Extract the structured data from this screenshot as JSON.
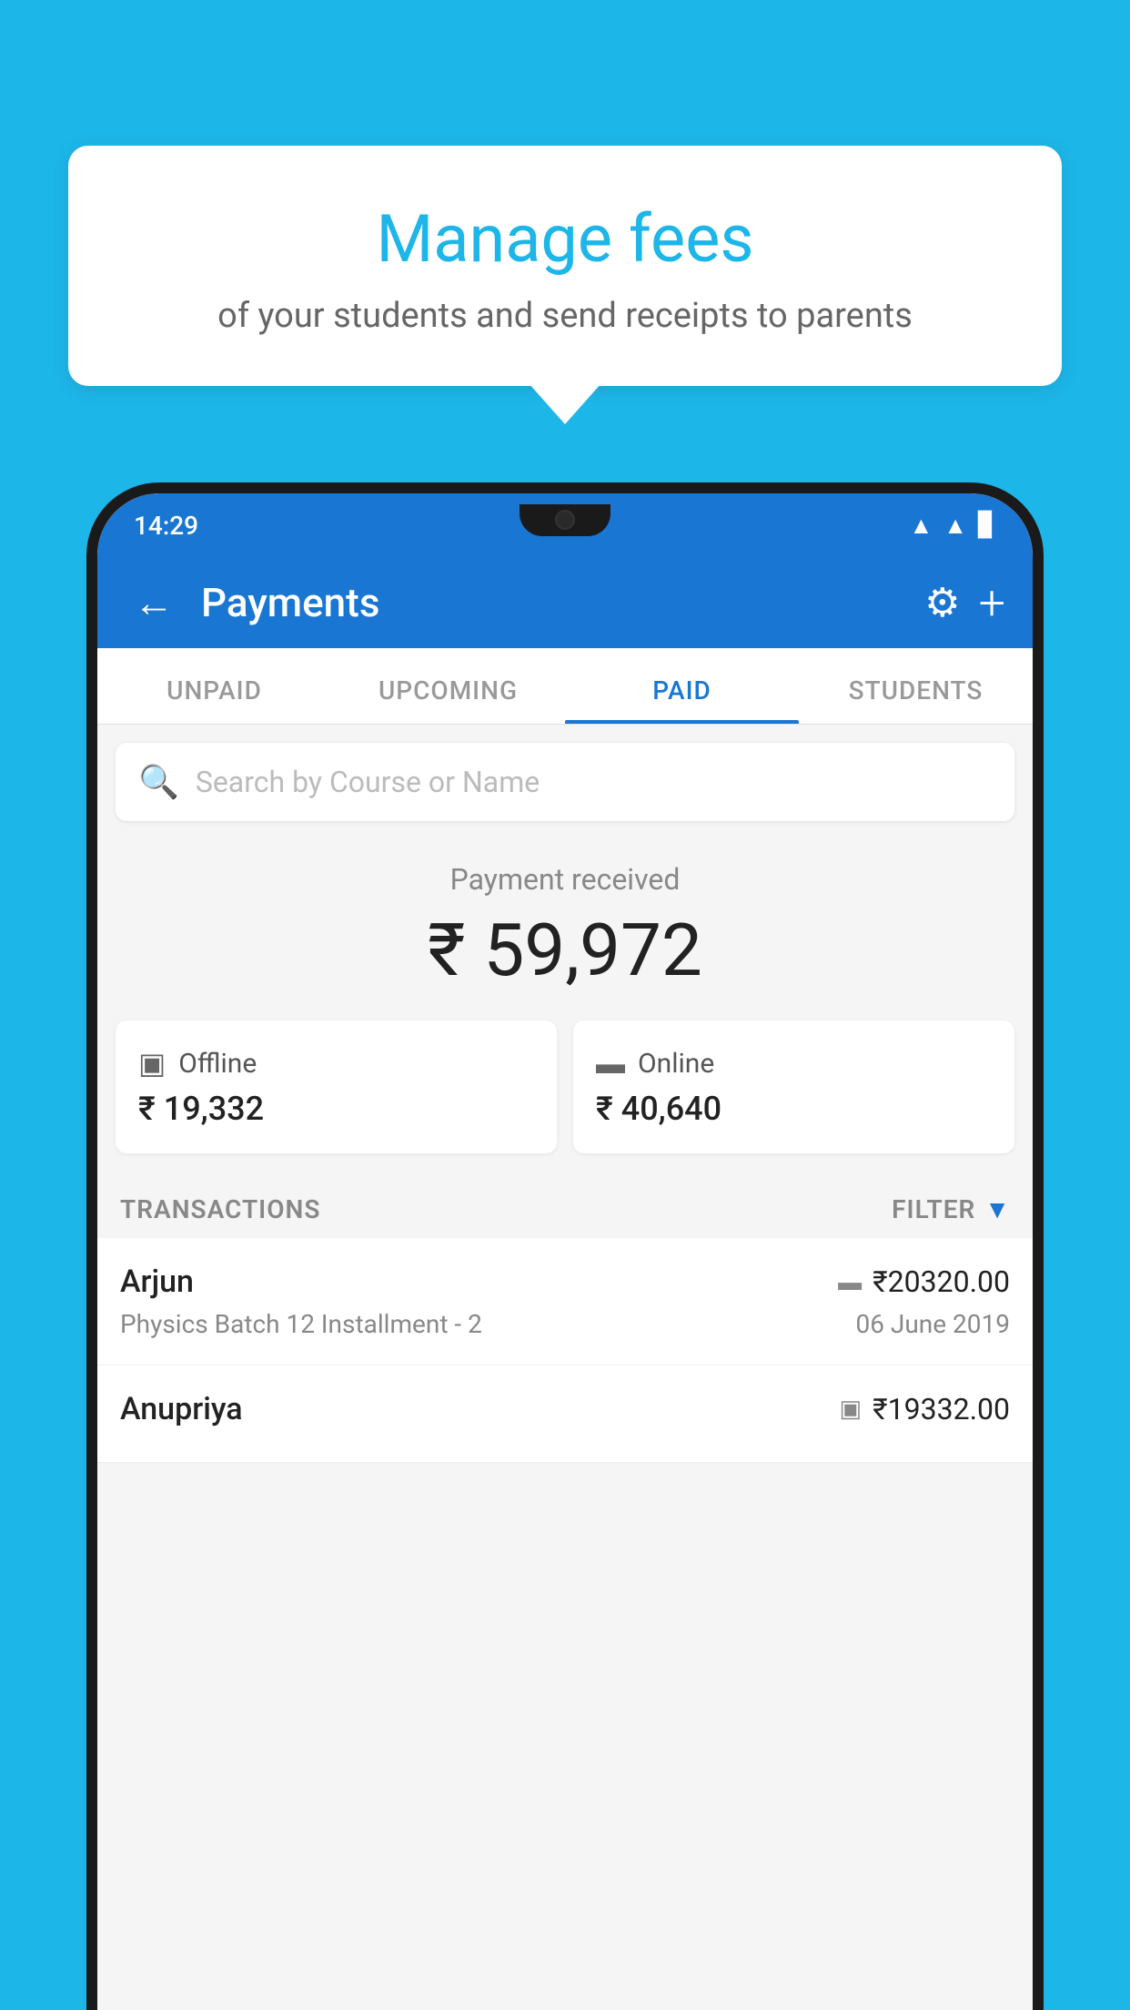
{
  "background_color": "#1DB6E8",
  "bubble": {
    "title": "Manage fees",
    "subtitle": "of your students and send receipts to parents"
  },
  "phone": {
    "status_bar": {
      "time": "14:29",
      "icons": [
        "wifi",
        "signal",
        "battery"
      ]
    },
    "app_bar": {
      "title": "Payments",
      "back_label": "←",
      "gear_label": "⚙",
      "plus_label": "+"
    },
    "tabs": [
      {
        "label": "UNPAID",
        "active": false
      },
      {
        "label": "UPCOMING",
        "active": false
      },
      {
        "label": "PAID",
        "active": true
      },
      {
        "label": "STUDENTS",
        "active": false
      }
    ],
    "search": {
      "placeholder": "Search by Course or Name"
    },
    "payment_summary": {
      "label": "Payment received",
      "amount": "₹ 59,972",
      "offline_label": "Offline",
      "offline_amount": "₹ 19,332",
      "online_label": "Online",
      "online_amount": "₹ 40,640"
    },
    "transactions": {
      "header_label": "TRANSACTIONS",
      "filter_label": "FILTER",
      "items": [
        {
          "name": "Arjun",
          "course": "Physics Batch 12 Installment - 2",
          "amount": "₹20320.00",
          "date": "06 June 2019",
          "type": "online"
        },
        {
          "name": "Anupriya",
          "course": "",
          "amount": "₹19332.00",
          "date": "",
          "type": "offline"
        }
      ]
    }
  }
}
